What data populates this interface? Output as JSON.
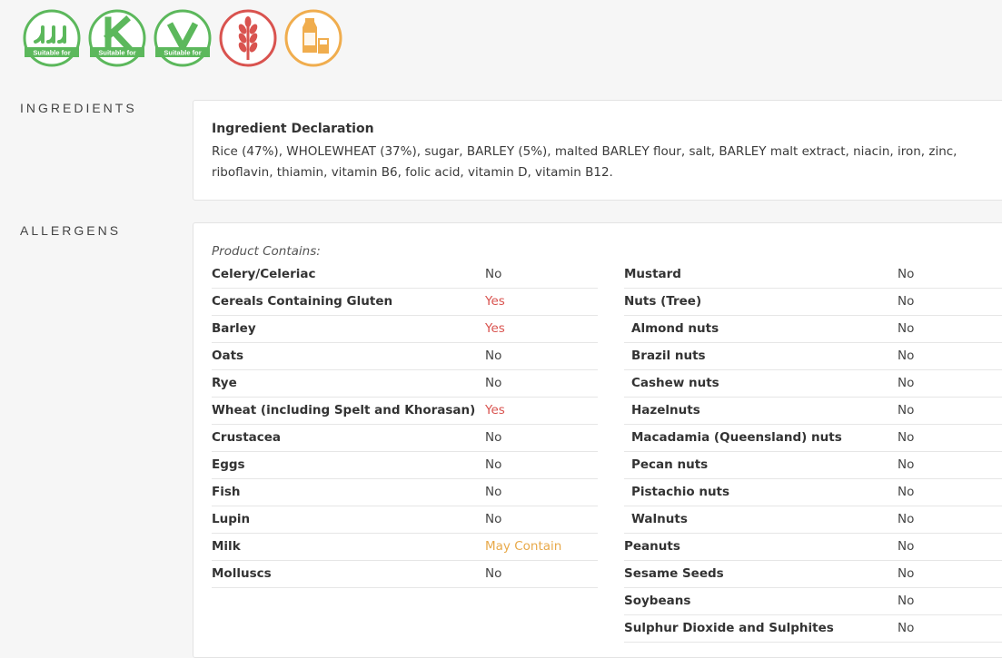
{
  "badges": [
    {
      "name": "halal",
      "label": "Suitable for",
      "color": "#5cb85c"
    },
    {
      "name": "kosher",
      "label": "Suitable for",
      "color": "#5cb85c"
    },
    {
      "name": "vegetarian",
      "label": "Suitable for",
      "color": "#5cb85c"
    },
    {
      "name": "gluten-icon",
      "color": "#d9534f"
    },
    {
      "name": "milk-icon",
      "color": "#f0ad4e"
    }
  ],
  "ingredients": {
    "section_label": "INGREDIENTS",
    "declaration_title": "Ingredient Declaration",
    "declaration_text": "Rice (47%), WHOLEWHEAT (37%), sugar, BARLEY (5%), malted BARLEY flour, salt, BARLEY malt extract, niacin, iron, zinc, riboflavin, thiamin, vitamin B6, folic acid, vitamin D, vitamin B12."
  },
  "allergens": {
    "section_label": "ALLERGENS",
    "contains_label": "Product Contains:",
    "left": [
      {
        "name": "Celery/Celeriac",
        "value": "No"
      },
      {
        "name": "Cereals Containing Gluten",
        "value": "Yes"
      },
      {
        "name": "Barley",
        "value": "Yes"
      },
      {
        "name": "Oats",
        "value": "No"
      },
      {
        "name": "Rye",
        "value": "No"
      },
      {
        "name": "Wheat (including Spelt and Khorasan)",
        "value": "Yes"
      },
      {
        "name": "Crustacea",
        "value": "No"
      },
      {
        "name": "Eggs",
        "value": "No"
      },
      {
        "name": "Fish",
        "value": "No"
      },
      {
        "name": "Lupin",
        "value": "No"
      },
      {
        "name": "Milk",
        "value": "May Contain"
      },
      {
        "name": "Molluscs",
        "value": "No"
      }
    ],
    "right": [
      {
        "name": "Mustard",
        "value": "No"
      },
      {
        "name": "Nuts (Tree)",
        "value": "No"
      },
      {
        "name": "Almond nuts",
        "value": "No",
        "sub": true
      },
      {
        "name": "Brazil nuts",
        "value": "No",
        "sub": true
      },
      {
        "name": "Cashew nuts",
        "value": "No",
        "sub": true
      },
      {
        "name": "Hazelnuts",
        "value": "No",
        "sub": true
      },
      {
        "name": "Macadamia (Queensland) nuts",
        "value": "No",
        "sub": true
      },
      {
        "name": "Pecan nuts",
        "value": "No",
        "sub": true
      },
      {
        "name": "Pistachio nuts",
        "value": "No",
        "sub": true
      },
      {
        "name": "Walnuts",
        "value": "No",
        "sub": true
      },
      {
        "name": "Peanuts",
        "value": "No"
      },
      {
        "name": "Sesame Seeds",
        "value": "No"
      },
      {
        "name": "Soybeans",
        "value": "No"
      },
      {
        "name": "Sulphur Dioxide and Sulphites",
        "value": "No"
      }
    ]
  }
}
